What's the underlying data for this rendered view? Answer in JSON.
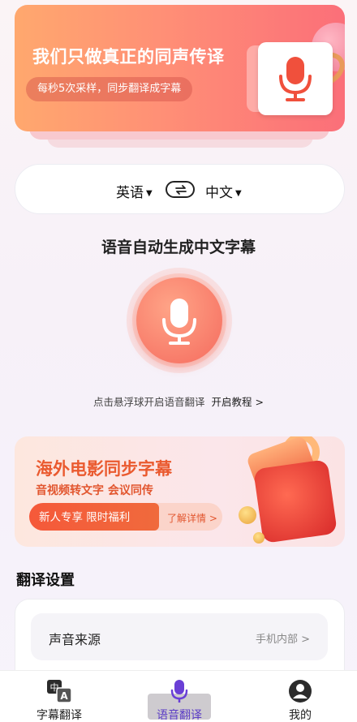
{
  "banner": {
    "title": "我们只做真正的同声传译",
    "pill": "每秒5次采样，同步翻译成字幕"
  },
  "language": {
    "source": "英语",
    "target": "中文"
  },
  "main": {
    "title": "语音自动生成中文字幕",
    "hint": "点击悬浮球开启语音翻译",
    "tutorial_link": "开启教程 >"
  },
  "promo": {
    "title": "海外电影同步字幕",
    "subtitle": "音视频转文字 会议同传",
    "pill": "新人专享 限时福利",
    "detail": "了解详情 >"
  },
  "settings": {
    "section_title": "翻译设置",
    "rows": [
      {
        "label": "声音来源",
        "value": "手机内部 >"
      }
    ]
  },
  "tabs": [
    {
      "label": "字幕翻译"
    },
    {
      "label": "语音翻译"
    },
    {
      "label": "我的"
    }
  ],
  "colors": {
    "accent": "#f56b5e",
    "promo_orange": "#ea5a2f",
    "active_tab": "#5b3cc6"
  }
}
